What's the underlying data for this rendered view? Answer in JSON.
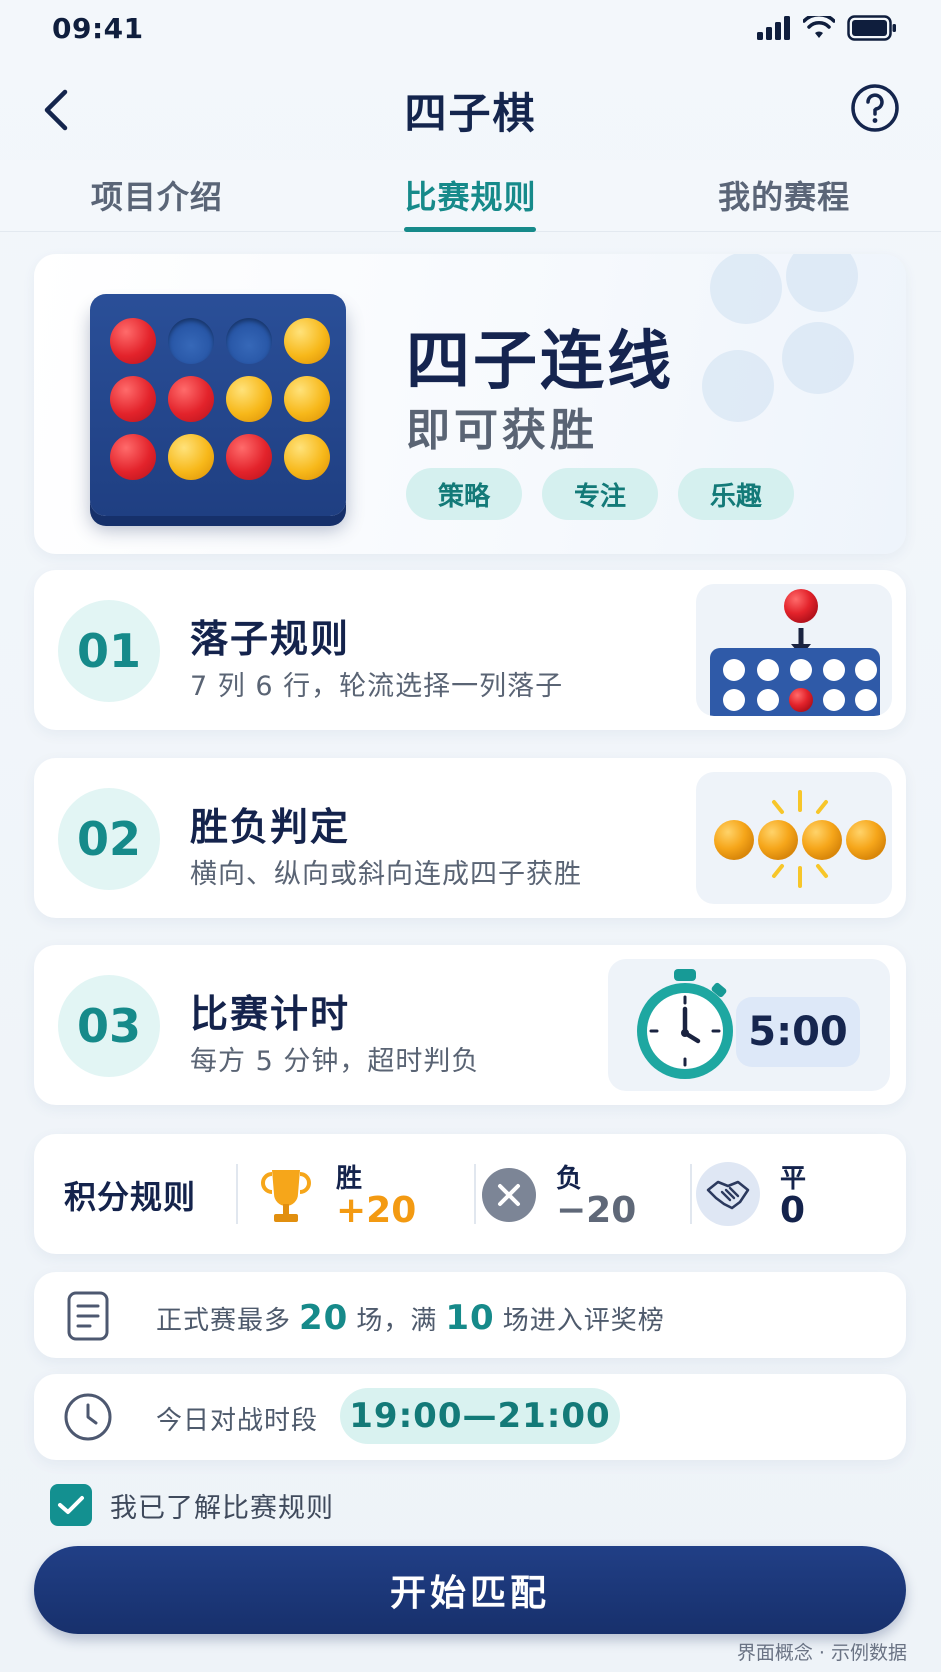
{
  "status_bar": {
    "time": "09:41"
  },
  "header": {
    "title": "四子棋"
  },
  "tabs": [
    {
      "label": "项目介绍",
      "active": false
    },
    {
      "label": "比赛规则",
      "active": true
    },
    {
      "label": "我的赛程",
      "active": false
    }
  ],
  "hero": {
    "title": "四子连线",
    "subtitle": "即可获胜",
    "tags": [
      "策略",
      "专注",
      "乐趣"
    ]
  },
  "rules": [
    {
      "number": "01",
      "title": "落子规则",
      "description": "7 列 6 行，轮流选择一列落子"
    },
    {
      "number": "02",
      "title": "胜负判定",
      "description": "横向、纵向或斜向连成四子获胜"
    },
    {
      "number": "03",
      "title": "比赛计时",
      "description": "每方 5 分钟，超时判负",
      "timer_value": "5:00"
    }
  ],
  "scoring": {
    "label": "积分规则",
    "win": {
      "label": "胜",
      "value": "+20"
    },
    "loss": {
      "label": "负",
      "value": "−20"
    },
    "draw": {
      "label": "平",
      "value": "0"
    }
  },
  "matches_info": {
    "prefix": "正式赛最多",
    "max_matches": "20",
    "middle": "场，满",
    "qualify_matches": "10",
    "suffix": "场进入评奖榜"
  },
  "schedule": {
    "label": "今日对战时段",
    "time_range": "19:00—21:00"
  },
  "agreement": {
    "label": "我已了解比赛规则",
    "checked": true
  },
  "start_button": {
    "label": "开始匹配"
  },
  "footnote": "界面概念 · 示例数据",
  "colors": {
    "primary": "#17306c",
    "accent": "#168a8a",
    "win": "#f39a12",
    "red_disc": "#e3232b",
    "yellow_disc": "#f7b81a"
  }
}
